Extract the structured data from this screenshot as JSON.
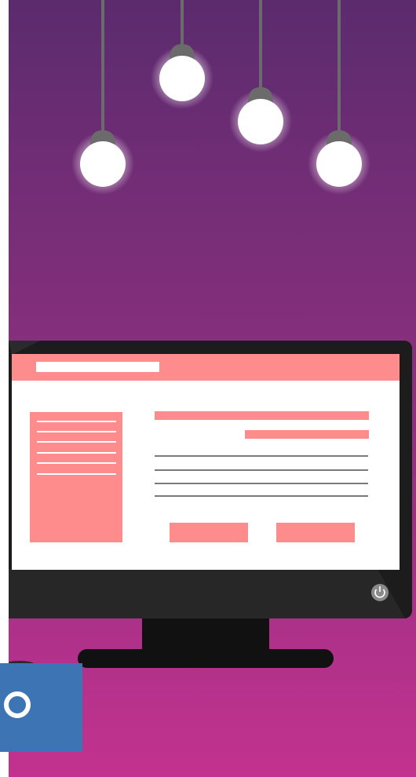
{
  "colors": {
    "background_top": "#5e2a70",
    "background_bottom": "#c0328e",
    "monitor_frame": "#1c1c1c",
    "monitor_bezel_bottom": "#272727",
    "screen_background": "#ffffff",
    "screen_accent": "#ff8c8c",
    "screen_lines": "#7a7a7a",
    "bulb_glow": "#ffffff",
    "cord": "#6b6b6b",
    "socket": "#6b6b6b",
    "badge": "#3d74b4"
  },
  "icons": {
    "power": "power-icon",
    "badge_ring": "ring-icon"
  },
  "bulbs": [
    {
      "name": "bulb-1"
    },
    {
      "name": "bulb-2"
    },
    {
      "name": "bulb-3"
    },
    {
      "name": "bulb-4"
    }
  ]
}
